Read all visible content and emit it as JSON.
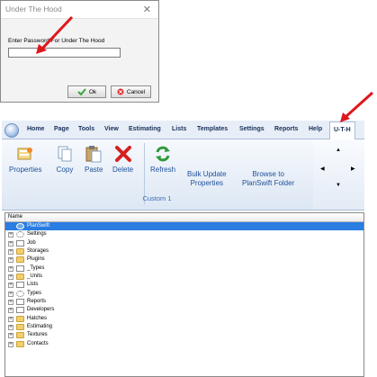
{
  "dialog": {
    "title": "Under The Hood",
    "close_glyph": "✕",
    "prompt": "Enter Password For Under The Hood",
    "password_value": "",
    "ok_label": "Ok",
    "cancel_label": "Cancel"
  },
  "ribbon": {
    "tabs": [
      "Home",
      "Page",
      "Tools",
      "View",
      "Estimating",
      "Lists",
      "Templates",
      "Settings",
      "Reports",
      "Help",
      "U-T-H"
    ],
    "active_tab": "U-T-H",
    "buttons": {
      "properties": "Properties",
      "copy": "Copy",
      "paste": "Paste",
      "delete": "Delete",
      "refresh": "Refresh",
      "bulk_update_1": "Bulk Update",
      "bulk_update_2": "Properties",
      "browse_1": "Browse to",
      "browse_2": "PlanSwift Folder"
    },
    "group_caption": "Custom 1",
    "accent_color": "#1e4f9a"
  },
  "tree": {
    "header": "Name",
    "rows": [
      {
        "label": "PlanSwift",
        "icon": "planswift-icon",
        "expander": false,
        "selected": true
      },
      {
        "label": "Settings",
        "icon": "gear-icon",
        "expander": true,
        "selected": false
      },
      {
        "label": "Job",
        "icon": "job-icon",
        "expander": true,
        "selected": false
      },
      {
        "label": "Storages",
        "icon": "folder-icon",
        "expander": true,
        "selected": false
      },
      {
        "label": "Plugins",
        "icon": "folder-icon",
        "expander": true,
        "selected": false
      },
      {
        "label": "_Types",
        "icon": "types-icon",
        "expander": true,
        "selected": false
      },
      {
        "label": "_Units",
        "icon": "folder-icon",
        "expander": true,
        "selected": false
      },
      {
        "label": "Lists",
        "icon": "list-icon",
        "expander": true,
        "selected": false
      },
      {
        "label": "Types",
        "icon": "gear-icon",
        "expander": true,
        "selected": false
      },
      {
        "label": "Reports",
        "icon": "report-icon",
        "expander": true,
        "selected": false
      },
      {
        "label": "Developers",
        "icon": "developers-icon",
        "expander": true,
        "selected": false
      },
      {
        "label": "Hatches",
        "icon": "folder-icon",
        "expander": true,
        "selected": false
      },
      {
        "label": "Estimating",
        "icon": "folder-icon",
        "expander": true,
        "selected": false
      },
      {
        "label": "Textures",
        "icon": "folder-icon",
        "expander": true,
        "selected": false
      },
      {
        "label": "Contacts",
        "icon": "folder-icon",
        "expander": true,
        "selected": false
      }
    ]
  },
  "colors": {
    "selection": "#2a7de1",
    "arrow": "#e0161b"
  }
}
